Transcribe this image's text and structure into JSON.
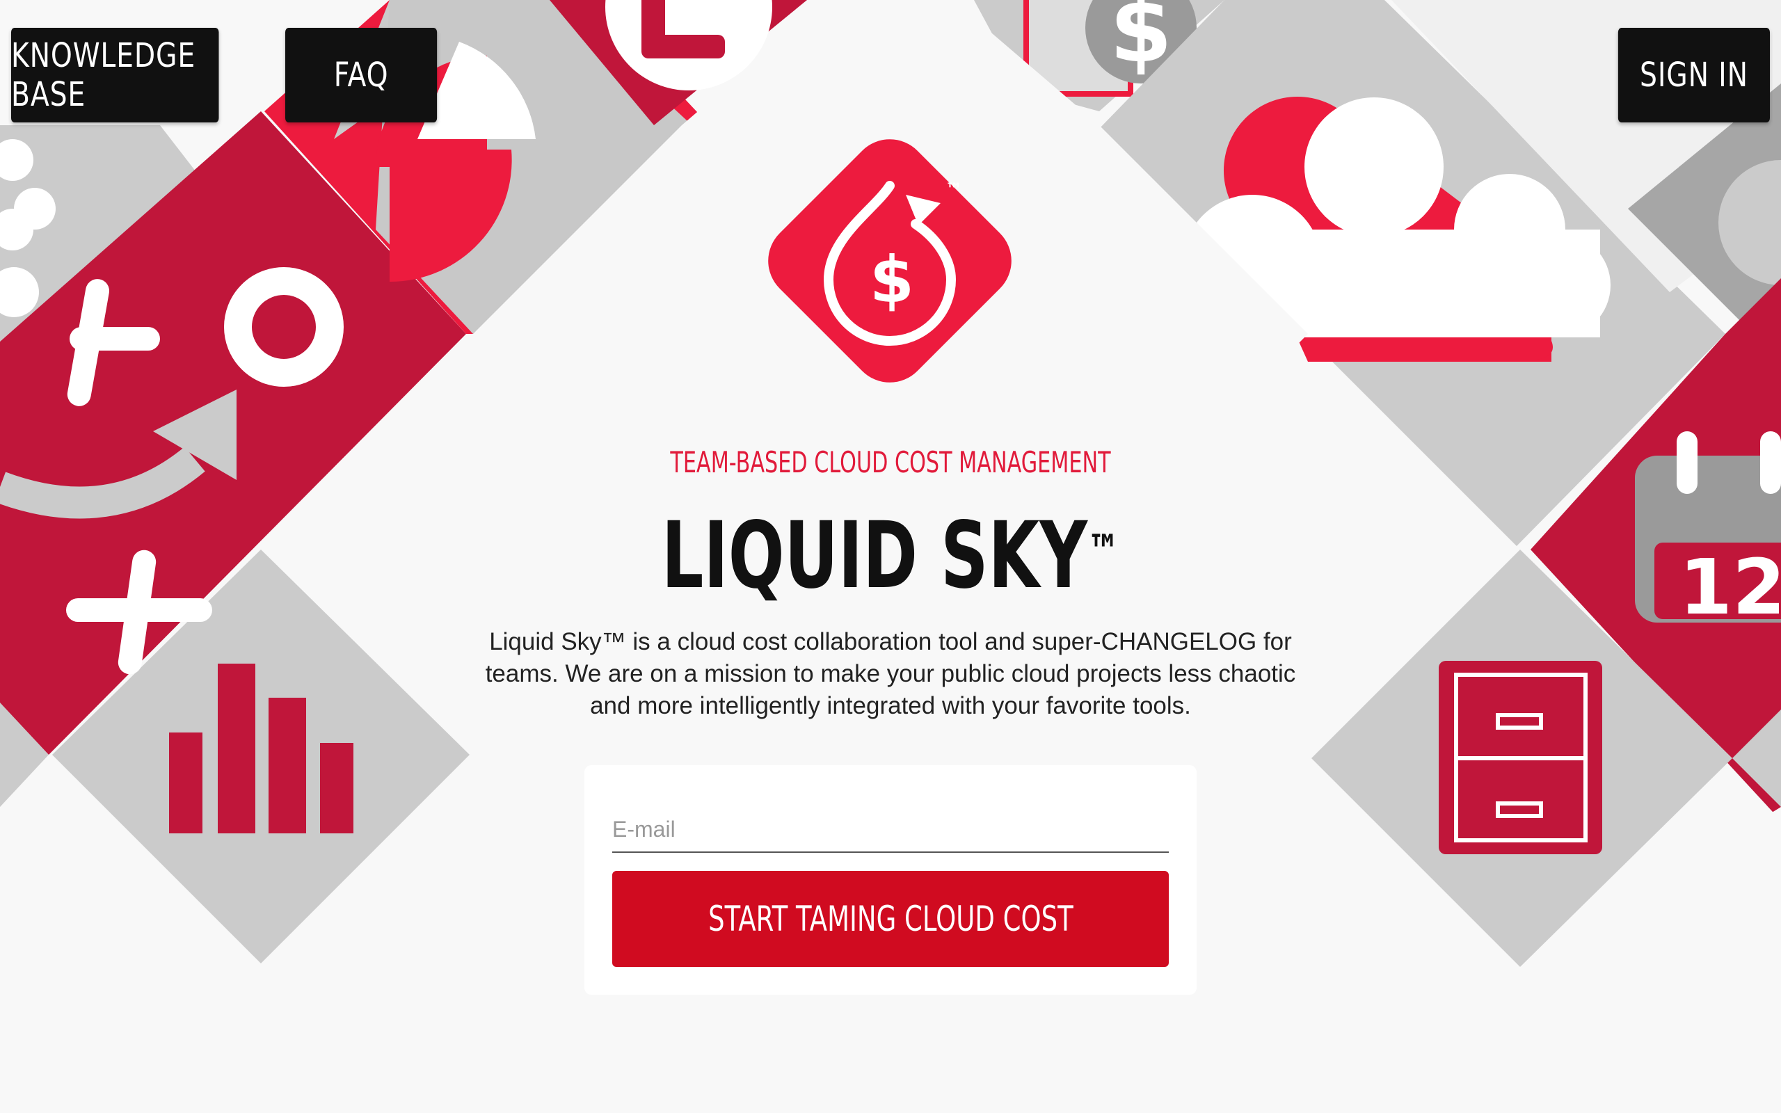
{
  "nav": {
    "knowledge_base_label": "KNOWLEDGE BASE",
    "faq_label": "FAQ",
    "sign_in_label": "SIGN IN"
  },
  "hero": {
    "tagline": "TEAM-BASED CLOUD COST MANAGEMENT",
    "title": "LIQUID SKY",
    "title_mark": "™",
    "logo_mark": "™",
    "logo_symbol": "$",
    "description": "Liquid Sky™ is a cloud cost collaboration tool and super-CHANGELOG for teams. We are on a mission to make your public cloud projects less chaotic and more intelligently integrated with your favorite tools."
  },
  "signup": {
    "email_placeholder": "E-mail",
    "email_value": "",
    "cta_label": "START TAMING CLOUD COST"
  },
  "background_tiles": {
    "calendar_day": "12",
    "dollar_symbol": "$"
  },
  "icons": [
    "dollar-drop-logo-icon",
    "bar-chart-icon",
    "cloud-icon",
    "calendar-icon",
    "file-cabinet-icon",
    "strategy-play-icon",
    "pie-chart-icon",
    "dollar-coin-icon",
    "clock-icon"
  ],
  "colors": {
    "background": "#f8f8f8",
    "tile_gray": "#cbcbcb",
    "tile_dark_gray": "#a6a6a6",
    "crimson": "#c0163a",
    "red": "#ed1b3e",
    "cta_red": "#d00b20",
    "nav_black": "#111111"
  }
}
